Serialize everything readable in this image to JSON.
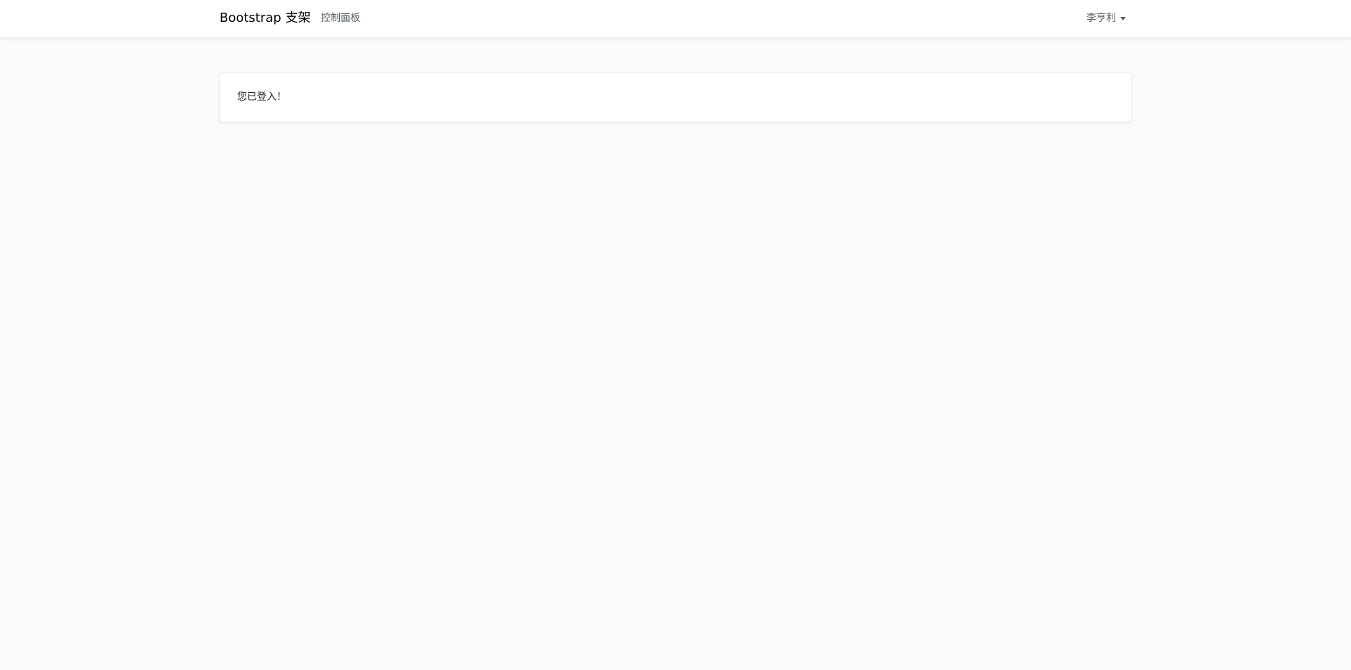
{
  "navbar": {
    "brand": "Bootstrap 支架",
    "links": [
      {
        "label": "控制面板"
      }
    ],
    "user": {
      "name": "李亨利"
    }
  },
  "main": {
    "card": {
      "message": "您已登入！"
    }
  },
  "colors": {
    "page_background": "#f8fafc",
    "navbar_background": "#ffffff",
    "card_background": "#ffffff",
    "nav_text": "#555b61"
  }
}
